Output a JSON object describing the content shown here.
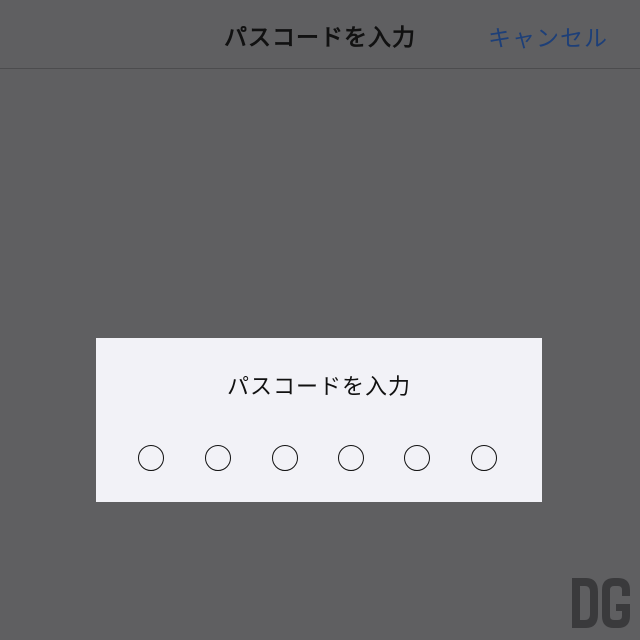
{
  "navbar": {
    "title": "パスコードを入力",
    "cancel_label": "キャンセル",
    "cancel_color": "#1d3f78"
  },
  "dialog": {
    "prompt": "パスコードを入力",
    "digit_count": 6,
    "digits_entered": 0
  },
  "colors": {
    "overlay": "#5f5f61",
    "dialog_background": "#f2f2f7"
  },
  "watermark": {
    "icon": "dg-logo-icon",
    "text": "DG"
  }
}
